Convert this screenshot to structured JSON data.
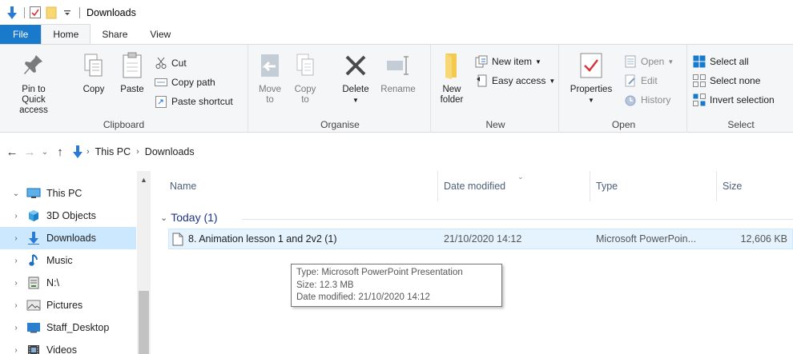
{
  "window": {
    "title": "Downloads"
  },
  "tabs": [
    "File",
    "Home",
    "Share",
    "View"
  ],
  "ribbon": {
    "clipboard": {
      "label": "Clipboard",
      "pin": "Pin to Quick access",
      "pin_line1": "Pin to Quick",
      "pin_line2": "access",
      "copy": "Copy",
      "paste": "Paste",
      "cut": "Cut",
      "copy_path": "Copy path",
      "paste_shortcut": "Paste shortcut"
    },
    "organise": {
      "label": "Organise",
      "move_to_1": "Move",
      "move_to_2": "to",
      "copy_to_1": "Copy",
      "copy_to_2": "to",
      "delete": "Delete",
      "rename": "Rename"
    },
    "new": {
      "label": "New",
      "new_folder_1": "New",
      "new_folder_2": "folder",
      "new_item": "New item",
      "easy_access": "Easy access"
    },
    "open": {
      "label": "Open",
      "properties": "Properties",
      "open": "Open",
      "edit": "Edit",
      "history": "History"
    },
    "select": {
      "label": "Select",
      "select_all": "Select all",
      "select_none": "Select none",
      "invert_selection": "Invert selection"
    }
  },
  "address": {
    "crumbs": [
      "This PC",
      "Downloads"
    ]
  },
  "nav": {
    "items": [
      {
        "label": "This PC",
        "icon": "pc-icon",
        "expanded": true
      },
      {
        "label": "3D Objects",
        "icon": "3d-objects-icon"
      },
      {
        "label": "Downloads",
        "icon": "downloads-icon",
        "selected": true
      },
      {
        "label": "Music",
        "icon": "music-icon"
      },
      {
        "label": "N:\\",
        "icon": "network-drive-icon"
      },
      {
        "label": "Pictures",
        "icon": "pictures-icon"
      },
      {
        "label": "Staff_Desktop",
        "icon": "desktop-icon"
      },
      {
        "label": "Videos",
        "icon": "videos-icon"
      }
    ]
  },
  "files": {
    "columns": [
      "Name",
      "Date modified",
      "Type",
      "Size"
    ],
    "group": "Today (1)",
    "rows": [
      {
        "name": "8. Animation lesson 1 and 2v2 (1)",
        "date": "21/10/2020 14:12",
        "type": "Microsoft PowerPoin...",
        "size": "12,606 KB"
      }
    ]
  },
  "tooltip": {
    "type": "Type: Microsoft PowerPoint Presentation",
    "size": "Size: 12.3 MB",
    "date": "Date modified: 21/10/2020 14:12"
  },
  "colors": {
    "accent": "#1979ca",
    "selection": "#cce8ff",
    "hover_row": "#e5f3ff",
    "folder": "#f8d775"
  }
}
